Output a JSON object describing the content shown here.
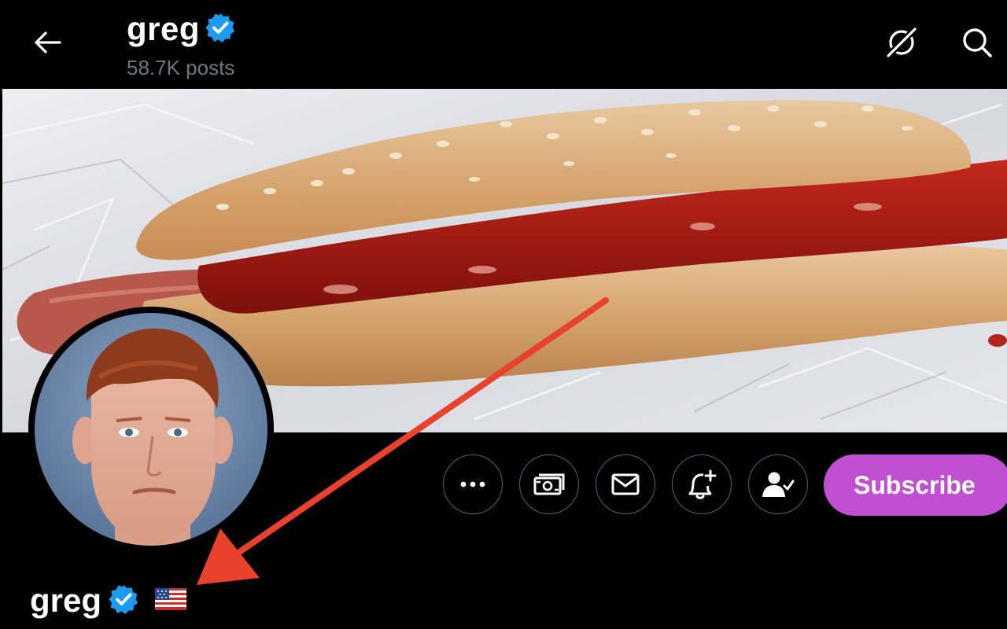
{
  "header": {
    "back_icon": "arrow-left-icon",
    "name": "greg",
    "posts": "58.7K posts",
    "grok_icon": "grok-icon",
    "search_icon": "search-icon"
  },
  "profile": {
    "name": "greg",
    "verified": true,
    "flag": "US flag",
    "subscribe_label": "Subscribe"
  },
  "actions": [
    {
      "name": "more",
      "icon": "more-icon"
    },
    {
      "name": "tip",
      "icon": "money-icon"
    },
    {
      "name": "message",
      "icon": "mail-icon"
    },
    {
      "name": "notifications",
      "icon": "bell-plus-icon"
    },
    {
      "name": "following",
      "icon": "person-check-icon"
    }
  ],
  "colors": {
    "background": "#000000",
    "verified": "#1d9bf0",
    "subscribe": "#c14fd1",
    "muted": "#71767b",
    "annotation_arrow": "#e8412c"
  }
}
